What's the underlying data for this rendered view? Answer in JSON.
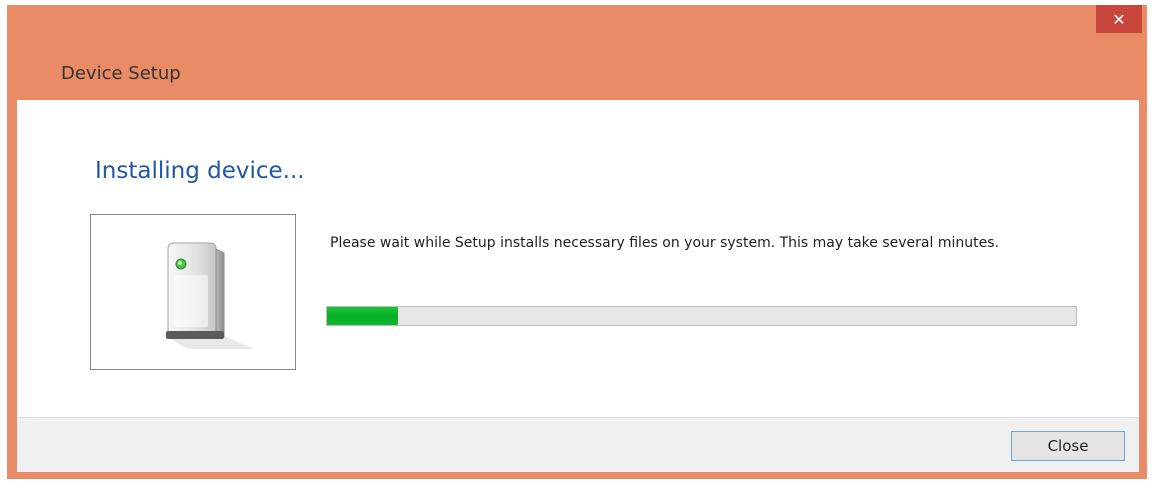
{
  "window": {
    "title": "Device Setup",
    "close_glyph": "✕",
    "titlebar_color": "#e98c66",
    "close_color": "#c9463d"
  },
  "main": {
    "heading": "Installing device...",
    "heading_color": "#1f57a4",
    "message": "Please wait while Setup installs necessary files on your system. This may take several minutes.",
    "device_icon": "computer-tower-icon",
    "progress_percent": 9.5,
    "progress_color": "#06b025"
  },
  "footer": {
    "close_label": "Close"
  }
}
